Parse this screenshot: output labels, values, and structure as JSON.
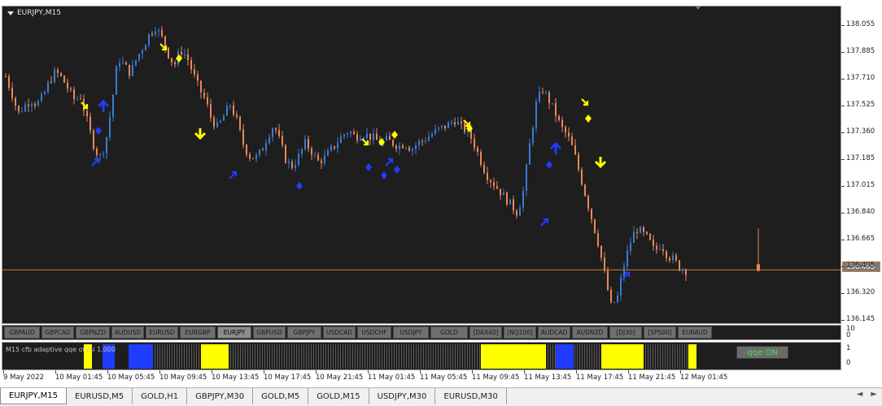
{
  "chart": {
    "title": "EURJPY,M15",
    "current_price": "136.483",
    "price_ticks": [
      "138.055",
      "137.885",
      "137.710",
      "137.525",
      "137.360",
      "137.185",
      "137.015",
      "136.840",
      "136.665",
      "136.495",
      "136.320",
      "136.145"
    ],
    "colors": {
      "background": "#1e1e1e",
      "bull": "#3a7bd5",
      "bear": "#e8885a",
      "price_line": "#d07a30",
      "signal_yellow": "#ffff00",
      "signal_blue": "#1f3cff"
    }
  },
  "symbols": [
    "GBPAUD",
    "GBPCAD",
    "GBPNZD",
    "AUDUSD",
    "EURUSD",
    "EURGBP",
    "EURJPY",
    "GBPUSD",
    "GBPJPY",
    "USDCAD",
    "USDCHF",
    "USDJPY",
    "GOLD",
    "[DAX40]",
    "[NQ100]",
    "AUDCAD",
    "AUDNZD",
    "[DJ30]",
    "[SP500]",
    "EURAUD"
  ],
  "active_symbol": "EURJPY",
  "symbol_axis": [
    "10",
    "0"
  ],
  "indicator": {
    "label": "M15  cfb adaptive qqe of rsi 1.000",
    "button": "qqe ON",
    "axis": [
      "1",
      "0"
    ]
  },
  "time_labels": [
    "9 May 2022",
    "10 May 01:45",
    "10 May 05:45",
    "10 May 09:45",
    "10 May 13:45",
    "10 May 17:45",
    "10 May 21:45",
    "11 May 01:45",
    "11 May 05:45",
    "11 May 09:45",
    "11 May 13:45",
    "11 May 17:45",
    "11 May 21:45",
    "12 May 01:45"
  ],
  "tabs": [
    "EURJPY,M15",
    "EURUSD,M5",
    "GOLD,H1",
    "GBPJPY,M30",
    "GOLD,M5",
    "GOLD,M15",
    "USDJPY,M30",
    "EURUSD,M30"
  ],
  "tab_nav": {
    "prev": "◄",
    "next": "►"
  },
  "price_path": [
    137.73,
    137.62,
    137.49,
    137.54,
    137.58,
    137.55,
    137.6,
    137.7,
    137.76,
    137.72,
    137.65,
    137.58,
    137.6,
    137.45,
    137.3,
    137.2,
    137.3,
    137.55,
    137.85,
    137.8,
    137.75,
    137.85,
    137.92,
    138.0,
    138.05,
    137.98,
    137.88,
    137.8,
    137.9,
    137.86,
    137.75,
    137.65,
    137.58,
    137.45,
    137.4,
    137.48,
    137.55,
    137.45,
    137.3,
    137.22,
    137.2,
    137.25,
    137.35,
    137.42,
    137.3,
    137.18,
    137.15,
    137.22,
    137.3,
    137.25,
    137.18,
    137.2,
    137.25,
    137.3,
    137.35,
    137.38,
    137.34,
    137.36,
    137.35,
    137.33,
    137.3,
    137.32,
    137.3,
    137.28,
    137.3,
    137.26,
    137.3,
    137.32,
    137.35,
    137.38,
    137.4,
    137.42,
    137.45,
    137.4,
    137.38,
    137.3,
    137.2,
    137.1,
    137.05,
    137.0,
    136.95,
    136.9,
    136.85,
    137.0,
    137.3,
    137.55,
    137.65,
    137.58,
    137.5,
    137.4,
    137.35,
    137.25,
    137.1,
    136.95,
    136.8,
    136.65,
    136.45,
    136.25,
    136.3,
    136.5,
    136.65,
    136.75,
    136.72,
    136.68,
    136.6,
    136.65,
    136.58,
    136.55,
    136.5,
    136.48
  ]
}
